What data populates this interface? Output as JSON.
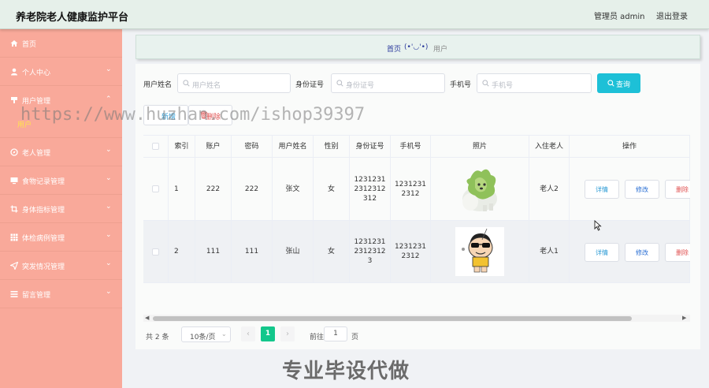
{
  "header": {
    "title": "养老院老人健康监护平台",
    "user": "管理员 admin",
    "logout": "退出登录"
  },
  "sidebar": {
    "items": [
      {
        "label": "首页",
        "icon": "home-icon"
      },
      {
        "label": "个人中心",
        "icon": "user-icon"
      },
      {
        "label": "用户管理",
        "icon": "pin-icon"
      },
      {
        "label": "老人管理",
        "icon": "compass-icon"
      },
      {
        "label": "食物记录管理",
        "icon": "monitor-icon"
      },
      {
        "label": "身体指标管理",
        "icon": "crop-icon"
      },
      {
        "label": "体检病例管理",
        "icon": "grid-icon"
      },
      {
        "label": "突发情况管理",
        "icon": "send-icon"
      },
      {
        "label": "留言管理",
        "icon": "list-icon"
      }
    ],
    "sub_item": "用户"
  },
  "breadcrumb": {
    "home": "首页",
    "face": "(•'◡'•)",
    "current": "用户"
  },
  "search": {
    "name_label": "用户姓名",
    "name_placeholder": "用户姓名",
    "id_label": "身份证号",
    "id_placeholder": "身份证号",
    "phone_label": "手机号",
    "phone_placeholder": "手机号",
    "button": "查询"
  },
  "actions": {
    "add": "新增",
    "delete": "删除"
  },
  "table": {
    "columns": [
      "索引",
      "账户",
      "密码",
      "用户姓名",
      "性别",
      "身份证号",
      "手机号",
      "照片",
      "入住老人",
      "操作"
    ],
    "rows": [
      {
        "index": "1",
        "account": "222",
        "password": "222",
        "name": "张文",
        "gender": "女",
        "id_line1": "1231231",
        "id_line2": "2312312",
        "id_line3": "312",
        "phone_line1": "1231231",
        "phone_line2": "2312",
        "elder": "老人2"
      },
      {
        "index": "2",
        "account": "111",
        "password": "111",
        "name": "张山",
        "gender": "女",
        "id_line1": "1231231",
        "id_line2": "2312312",
        "id_line3": "3",
        "phone_line1": "1231231",
        "phone_line2": "2312",
        "elder": "老人1"
      }
    ],
    "op_detail": "详情",
    "op_edit": "修改",
    "op_delete": "删除"
  },
  "pagination": {
    "total": "共 2 条",
    "page_size": "10条/页",
    "current": "1",
    "goto_label": "前往",
    "goto_value": "1",
    "page_suffix": "页"
  },
  "overlays": {
    "watermark": "https://www.huzhan.com/ishop39397",
    "banner": "专业毕设代做"
  },
  "colors": {
    "sidebar": "#f9a99a",
    "accent": "#1dc0d7",
    "page_active": "#13c78b"
  }
}
